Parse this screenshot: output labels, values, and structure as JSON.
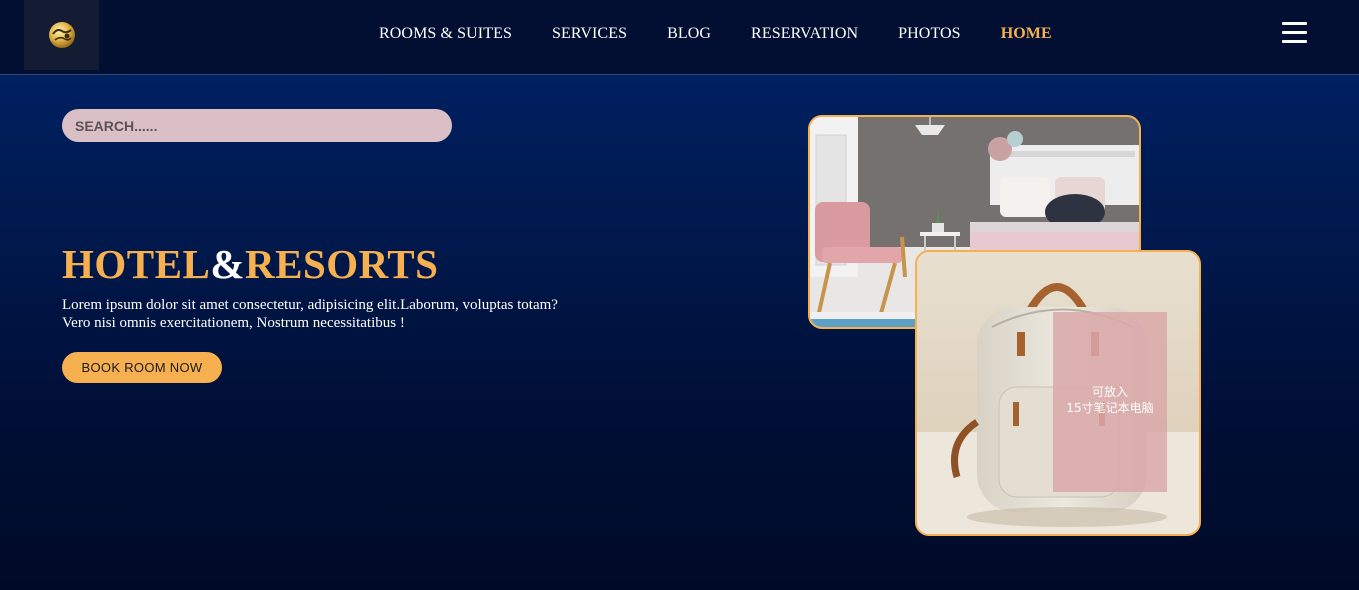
{
  "navbar": {
    "logo_icon": "globe-logo-icon",
    "links": [
      {
        "label": "ROOMS & SUITES"
      },
      {
        "label": "SERVICES"
      },
      {
        "label": "BLOG"
      },
      {
        "label": "RESERVATION"
      },
      {
        "label": "PHOTOS"
      },
      {
        "label": "HOME",
        "active": true
      }
    ],
    "menu_icon": "hamburger-menu-icon"
  },
  "search": {
    "placeholder": "SEARCH......"
  },
  "hero": {
    "title_part1": "HOTEL",
    "title_amp": "&",
    "title_part2": "RESORTS",
    "description": "Lorem ipsum dolor sit amet consectetur, adipisicing elit.Laborum, voluptas totam? Vero nisi omnis exercitationem, Nostrum necessitatibus !",
    "button_label": "BOOK ROOM NOW"
  },
  "images": {
    "bag_caption_line1": "可放入",
    "bag_caption_line2": "15寸笔记本电脑"
  },
  "colors": {
    "accent": "#f7b04f",
    "navbar_bg": "#020f32",
    "search_bg": "#dbbfc6"
  }
}
